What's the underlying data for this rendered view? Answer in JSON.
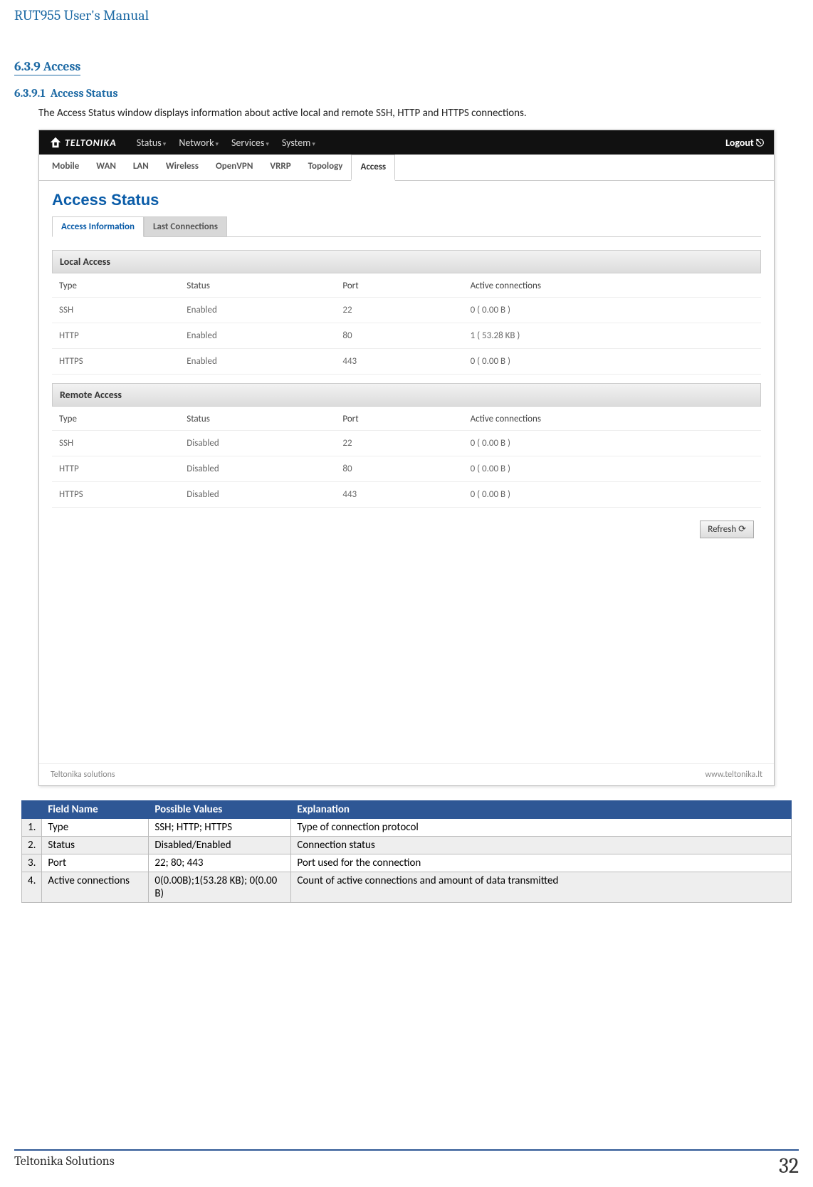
{
  "doc_title": "RUT955 User's Manual",
  "section_num": "6.3.9",
  "section_label": "Access",
  "subsection_num": "6.3.9.1",
  "subsection_label": "Access Status",
  "intro": "The Access Status window displays information about active local and remote SSH, HTTP and HTTPS connections.",
  "nav": {
    "brand": "TELTONIKA",
    "items": [
      "Status",
      "Network",
      "Services",
      "System"
    ],
    "logout": "Logout"
  },
  "subnav": {
    "items": [
      "Mobile",
      "WAN",
      "LAN",
      "Wireless",
      "OpenVPN",
      "VRRP",
      "Topology",
      "Access"
    ],
    "active": "Access"
  },
  "page_title": "Access Status",
  "subtabs": {
    "items": [
      "Access Information",
      "Last Connections"
    ],
    "active": "Access Information"
  },
  "headers": {
    "type": "Type",
    "status": "Status",
    "port": "Port",
    "conns": "Active connections"
  },
  "local": {
    "title": "Local Access",
    "rows": [
      {
        "type": "SSH",
        "status": "Enabled",
        "port": "22",
        "conns": "0 ( 0.00 B )"
      },
      {
        "type": "HTTP",
        "status": "Enabled",
        "port": "80",
        "conns": "1 ( 53.28 KB )"
      },
      {
        "type": "HTTPS",
        "status": "Enabled",
        "port": "443",
        "conns": "0 ( 0.00 B )"
      }
    ]
  },
  "remote": {
    "title": "Remote Access",
    "rows": [
      {
        "type": "SSH",
        "status": "Disabled",
        "port": "22",
        "conns": "0 ( 0.00 B )"
      },
      {
        "type": "HTTP",
        "status": "Disabled",
        "port": "80",
        "conns": "0 ( 0.00 B )"
      },
      {
        "type": "HTTPS",
        "status": "Disabled",
        "port": "443",
        "conns": "0 ( 0.00 B )"
      }
    ]
  },
  "refresh": "Refresh",
  "footer_ss": {
    "left": "Teltonika solutions",
    "right": "www.teltonika.lt"
  },
  "table": {
    "headers": {
      "name": "Field Name",
      "values": "Possible Values",
      "expl": "Explanation"
    },
    "rows": [
      {
        "n": "1.",
        "name": "Type",
        "values": "SSH; HTTP; HTTPS",
        "expl": "Type of connection protocol"
      },
      {
        "n": "2.",
        "name": "Status",
        "values": "Disabled/Enabled",
        "expl": "Connection status"
      },
      {
        "n": "3.",
        "name": "Port",
        "values": "22; 80; 443",
        "expl": "Port used for the connection"
      },
      {
        "n": "4.",
        "name": "Active connections",
        "values": "0(0.00B);1(53.28 KB); 0(0.00 B)",
        "expl": "Count of active connections and amount of data transmitted"
      }
    ]
  },
  "doc_footer": {
    "brand": "Teltonika Solutions",
    "page": "32"
  }
}
